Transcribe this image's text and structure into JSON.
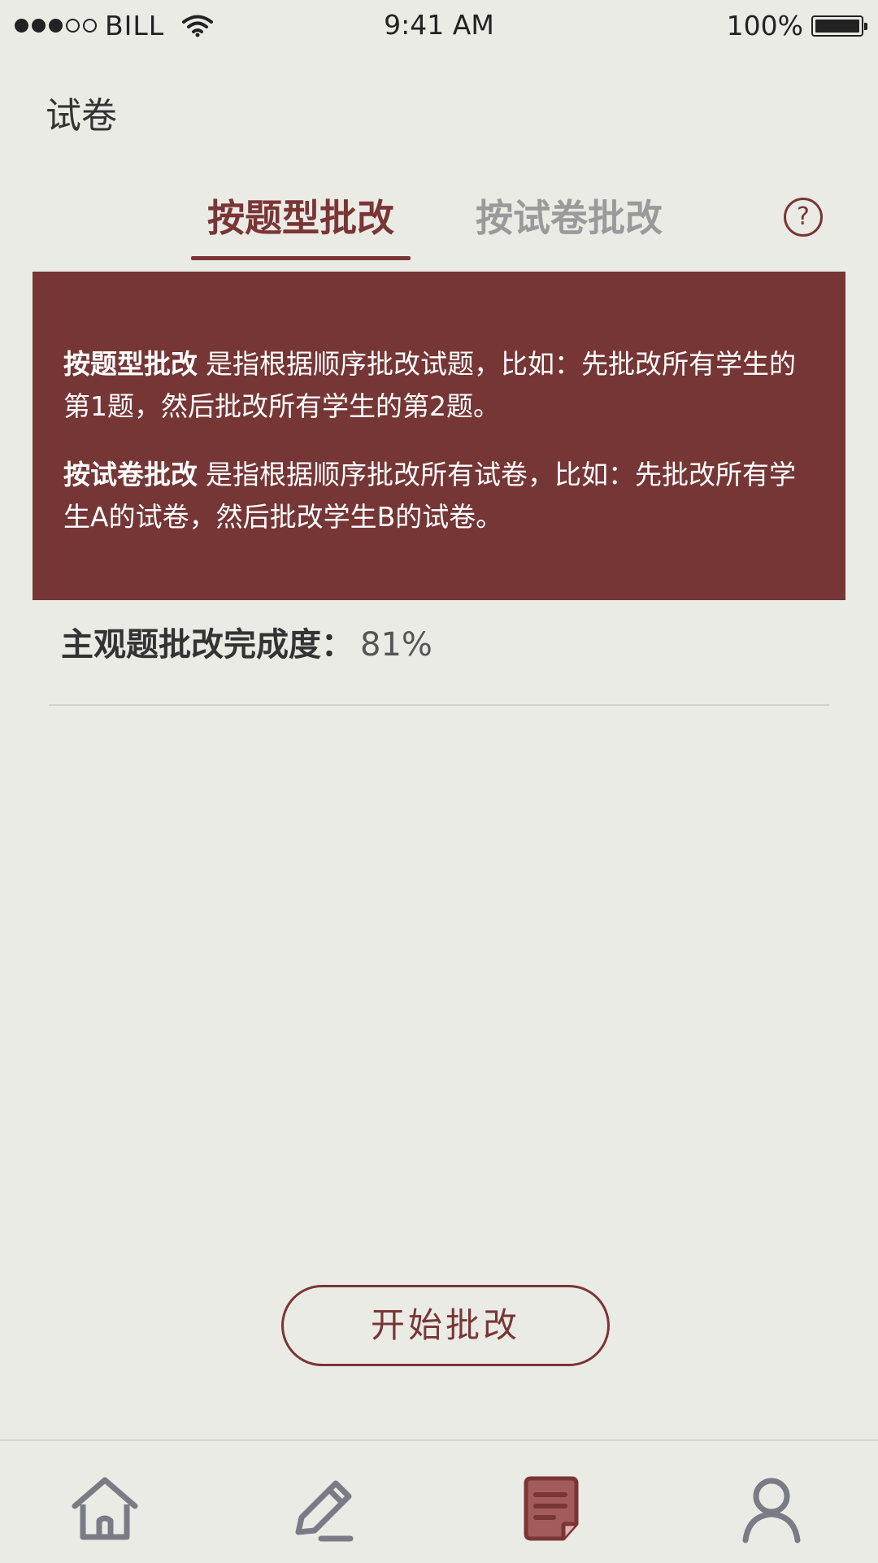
{
  "status_bar": {
    "carrier": "BILL",
    "time": "9:41 AM",
    "battery": "100%"
  },
  "page": {
    "title": "试卷"
  },
  "tabs": [
    {
      "label": "按题型批改",
      "active": true
    },
    {
      "label": "按试卷批改",
      "active": false
    }
  ],
  "help": {
    "icon": "question-circle-icon",
    "glyph": "?"
  },
  "info_panel": {
    "item1_title": "按题型批改",
    "item1_text": "是指根据顺序批改试题，比如：先批改所有学生的第1题，然后批改所有学生的第2题。",
    "item2_title": "按试卷批改",
    "item2_text": "是指根据顺序批改所有试卷，比如：先批改所有学生A的试卷，然后批改学生B的试卷。"
  },
  "progress": {
    "label": "主观题批改完成度：",
    "value": "81%",
    "fraction": 0.81
  },
  "start_button": {
    "label": "开始批改"
  },
  "bottom_nav": [
    {
      "icon": "home-icon",
      "active": false
    },
    {
      "icon": "pencil-icon",
      "active": false
    },
    {
      "icon": "document-icon",
      "active": true
    },
    {
      "icon": "user-icon",
      "active": false
    }
  ],
  "colors": {
    "accent": "#7a3535",
    "panel_bg": "#763636",
    "background": "#ebebe6",
    "inactive_tab": "#9a9a9a",
    "nav_icon": "#7b7b86"
  }
}
